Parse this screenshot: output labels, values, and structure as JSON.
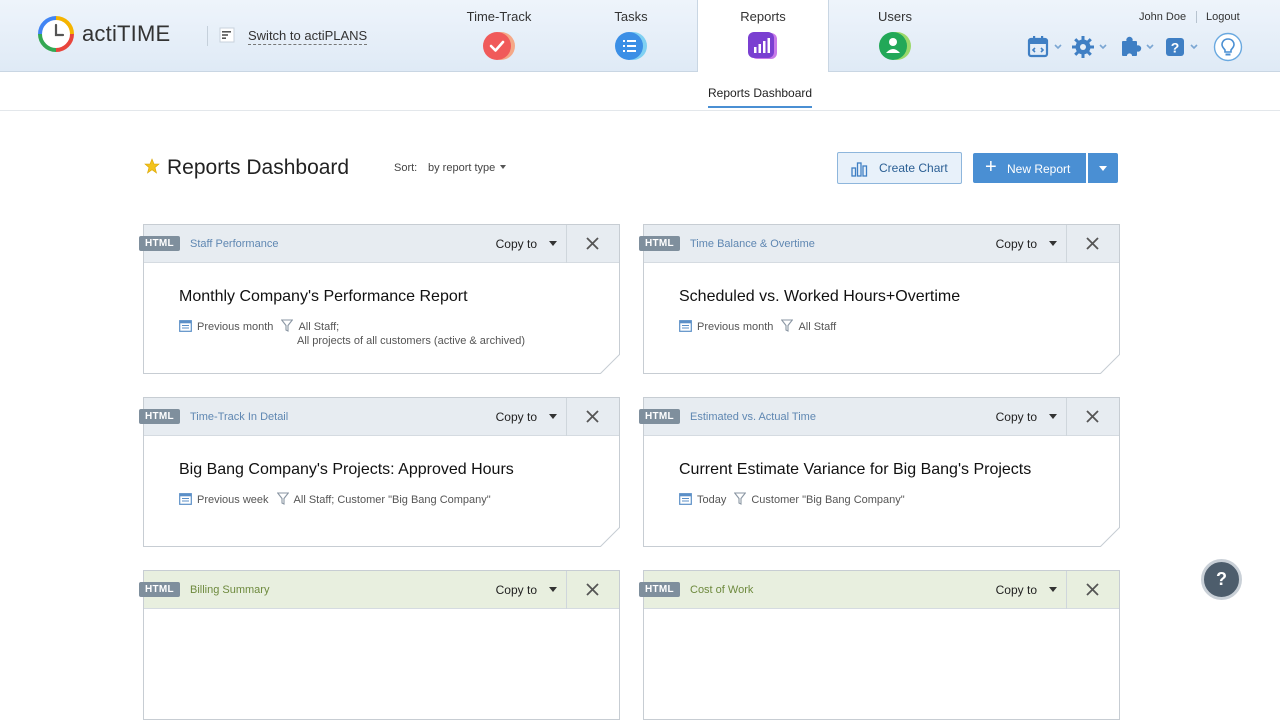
{
  "header": {
    "logo_text": "actiTIME",
    "switch_label": "Switch to actiPLANS",
    "modules": [
      {
        "label": "Time-Track",
        "icon": "time-track-icon",
        "color": "#f06257"
      },
      {
        "label": "Tasks",
        "icon": "tasks-icon",
        "color": "#3a9be8"
      },
      {
        "label": "Reports",
        "icon": "reports-icon",
        "color": "#8a4ad6"
      },
      {
        "label": "Users",
        "icon": "users-icon",
        "color": "#2eb05b"
      }
    ],
    "user_name": "John Doe",
    "logout": "Logout"
  },
  "subnav": {
    "active_tab": "Reports Dashboard"
  },
  "page": {
    "title": "Reports Dashboard",
    "sort_label": "Sort:",
    "sort_value": "by report type",
    "create_chart": "Create Chart",
    "new_report": "New Report"
  },
  "cards": [
    {
      "badge": "HTML",
      "type": "Staff Performance",
      "copy": "Copy to",
      "title": "Monthly Company's Performance Report",
      "period": "Previous month",
      "filter": "All Staff;",
      "filter2": "All projects of all customers (active & archived)"
    },
    {
      "badge": "HTML",
      "type": "Time Balance & Overtime",
      "copy": "Copy to",
      "title": "Scheduled vs. Worked Hours+Overtime",
      "period": "Previous month",
      "filter": "All Staff",
      "filter2": ""
    },
    {
      "badge": "HTML",
      "type": "Time-Track In Detail",
      "copy": "Copy to",
      "title": "Big Bang Company's Projects: Approved Hours",
      "period": "Previous week",
      "filter": "All Staff; Customer \"Big Bang Company\"",
      "filter2": ""
    },
    {
      "badge": "HTML",
      "type": "Estimated vs. Actual Time",
      "copy": "Copy to",
      "title": "Current Estimate Variance for Big Bang's Projects",
      "period": "Today",
      "filter": "Customer \"Big Bang Company\"",
      "filter2": ""
    },
    {
      "badge": "HTML",
      "type": "Billing Summary",
      "copy": "Copy to"
    },
    {
      "badge": "HTML",
      "type": "Cost of Work",
      "copy": "Copy to"
    }
  ],
  "help_fab": "?"
}
